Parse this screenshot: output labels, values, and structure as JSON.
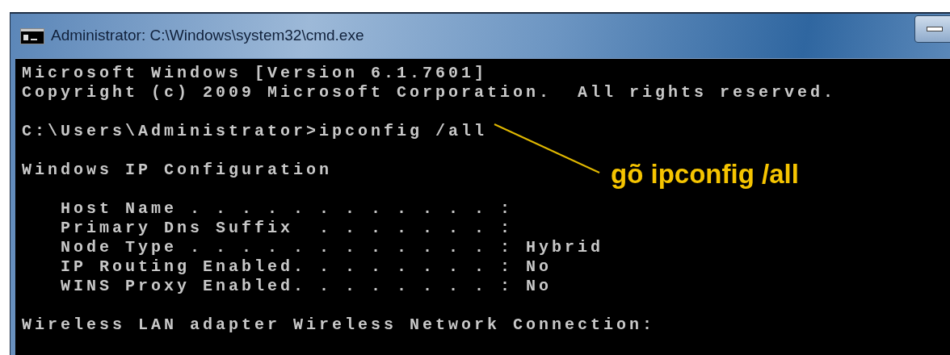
{
  "window": {
    "title": "Administrator: C:\\Windows\\system32\\cmd.exe"
  },
  "console": {
    "paragraphs": [
      [
        "Microsoft Windows [Version 6.1.7601]",
        "Copyright (c) 2009 Microsoft Corporation.  All rights reserved."
      ],
      [
        "C:\\Users\\Administrator>ipconfig /all"
      ],
      [
        "Windows IP Configuration"
      ],
      [
        "   Host Name . . . . . . . . . . . . :",
        "   Primary Dns Suffix  . . . . . . . :",
        "   Node Type . . . . . . . . . . . . : Hybrid",
        "   IP Routing Enabled. . . . . . . . : No",
        "   WINS Proxy Enabled. . . . . . . . : No"
      ],
      [
        "Wireless LAN adapter Wireless Network Connection:"
      ]
    ]
  },
  "annotation": {
    "text": "gõ ipconfig /all"
  }
}
